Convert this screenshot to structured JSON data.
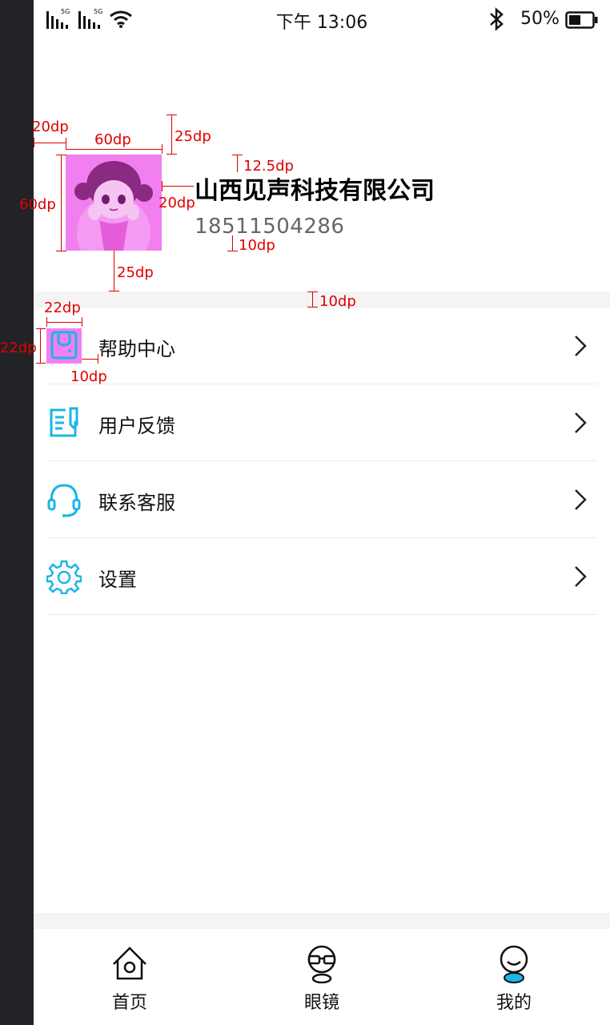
{
  "status_bar": {
    "network_1": "5G",
    "network_2": "5G",
    "time": "下午 13:06",
    "battery": "50%"
  },
  "profile": {
    "company": "山西见声科技有限公司",
    "phone": "18511504286"
  },
  "annotations": {
    "left_margin": "20dp",
    "avatar_width": "60dp",
    "top_space": "25dp",
    "name_top": "12.5dp",
    "avatar_height": "60dp",
    "avatar_text_gap": "20dp",
    "phone_gap": "10dp",
    "bottom_space": "25dp",
    "band_height": "10dp",
    "icon_width": "22dp",
    "icon_height": "22dp",
    "icon_text_gap": "10dp"
  },
  "menu": [
    {
      "label": "帮助中心",
      "icon": "bag-icon"
    },
    {
      "label": "用户反馈",
      "icon": "feedback-icon"
    },
    {
      "label": "联系客服",
      "icon": "headset-icon"
    },
    {
      "label": "设置",
      "icon": "gear-icon"
    }
  ],
  "tabs": [
    {
      "label": "首页",
      "icon": "home-icon"
    },
    {
      "label": "眼镜",
      "icon": "glasses-icon"
    },
    {
      "label": "我的",
      "icon": "profile-icon"
    }
  ],
  "colors": {
    "accent": "#1ab6e6",
    "annotation": "#e00000",
    "avatar_tint": "#f27ff0",
    "icon_highlight": "#f27ff0"
  }
}
